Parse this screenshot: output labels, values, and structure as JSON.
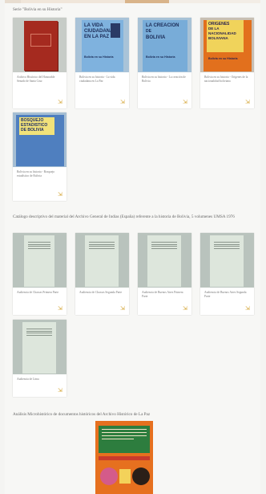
{
  "sections": [
    {
      "title": "Serie \"Bolivia en su Historia\"",
      "cards": [
        {
          "caption": "Archivo Histórico del Honorable Senado de Santa Cruz"
        },
        {
          "caption": "Bolivia en su historia - La vida ciudadana en La Paz"
        },
        {
          "caption": "Bolivia en su historia - La creación de Bolivia"
        },
        {
          "caption": "Bolivia en su historia - Orígenes de la nacionalidad boliviana"
        },
        {
          "caption": "Bolivia en su historia - Bosquejo estadístico de Bolivia"
        }
      ]
    },
    {
      "title": "Catálogo descriptivo del material del Archivo General de Indias (España) referente a la historia de Bolivia, 5 volumenes UMSA 1976",
      "cards": [
        {
          "caption": "Audiencia de Charcas Primera Parte"
        },
        {
          "caption": "Audiencia de Charcas Segunda Parte"
        },
        {
          "caption": "Audiencia de Buenos Aires Primera Parte"
        },
        {
          "caption": "Audiencia de Buenos Aires Segunda Parte"
        },
        {
          "caption": "Audiencia de Lima"
        }
      ]
    },
    {
      "title": "Análisis Microhistórico de documentos históricos del Archivo Histórico de La Paz"
    }
  ],
  "covers": {
    "vida": {
      "line1": "LA VIDA",
      "line2": "CIUDADANA",
      "line3": "EN LA PAZ",
      "footer": "Bolivia en su Historia"
    },
    "creacion": {
      "line1": "LA CREACION",
      "line2": "DE",
      "line3": "BOLIVIA",
      "footer": "Bolivia en su Historia"
    },
    "origenes": {
      "line1": "ORIGENES",
      "line2": "DE LA",
      "line3": "NACIONALIDAD",
      "line4": "BOLIVIANA",
      "footer": "Bolivia en su Historia"
    },
    "bosquejo": {
      "line1": "BOSQUEJO",
      "line2": "ESTADISTICO",
      "line3": "DE BOLIVIA"
    }
  },
  "icons": {
    "card_corner": "expand-arrow-icon"
  },
  "colors": {
    "accent": "#d4a433",
    "background": "#f7f7f5"
  }
}
